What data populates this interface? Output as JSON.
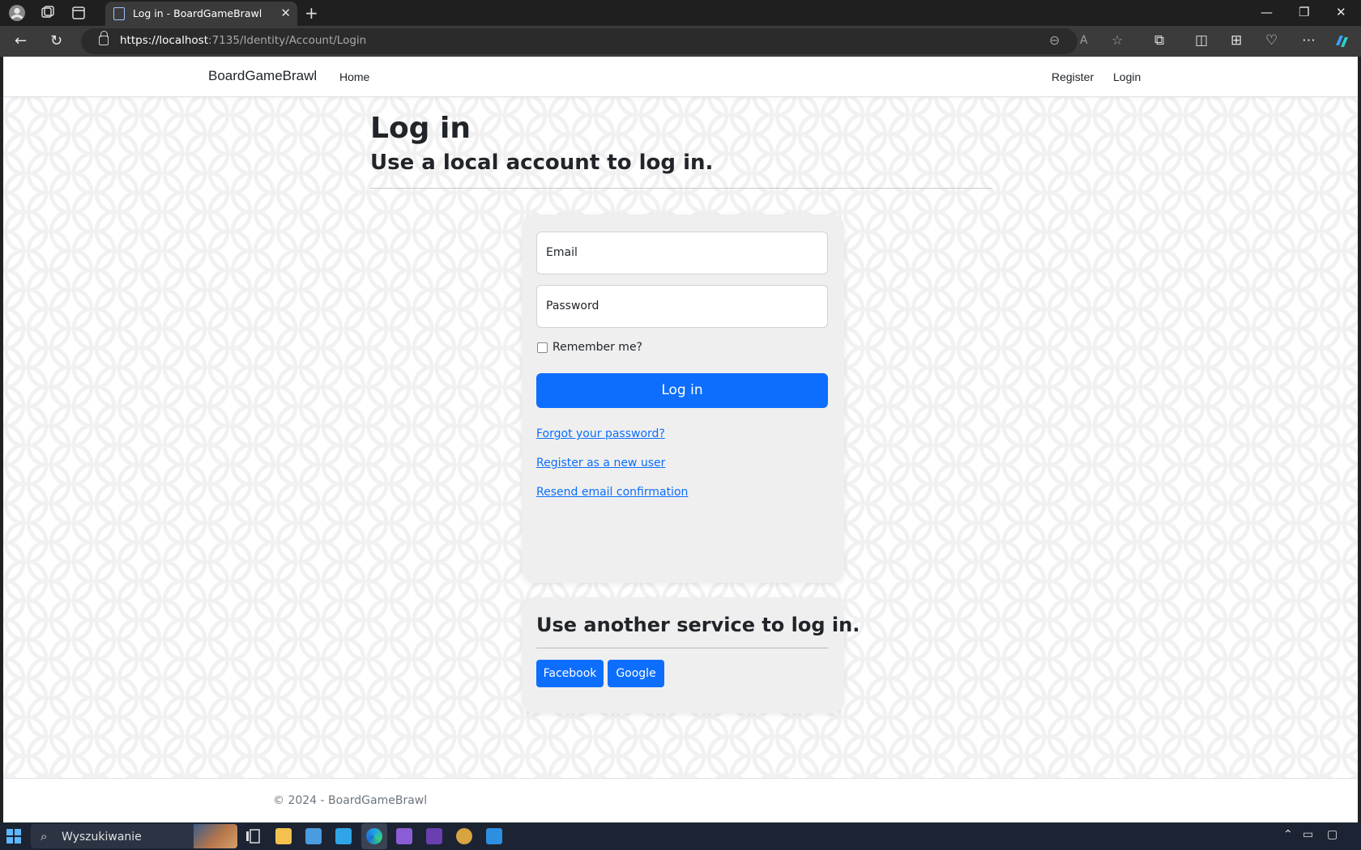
{
  "browser": {
    "tab_title": "Log in - BoardGameBrawl",
    "tab_close": "✕",
    "new_tab": "+",
    "url_host": "https://localhost",
    "url_path": ":7135/Identity/Account/Login",
    "window_controls": {
      "minimize": "—",
      "restore": "❐",
      "close": "✕"
    }
  },
  "site": {
    "brand": "BoardGameBrawl",
    "nav": {
      "home": "Home",
      "register": "Register",
      "login": "Login"
    }
  },
  "page": {
    "title": "Log in",
    "subtitle": "Use a local account to log in."
  },
  "form": {
    "email_label": "Email",
    "password_label": "Password",
    "remember_label": "Remember me?",
    "remember_checked": false,
    "submit_label": "Log in",
    "links": {
      "forgot": "Forgot your password?",
      "register": "Register as a new user",
      "resend": "Resend email confirmation"
    }
  },
  "external": {
    "title": "Use another service to log in.",
    "facebook": "Facebook",
    "google": "Google"
  },
  "footer": {
    "copyright": "© 2024 - BoardGameBrawl"
  },
  "taskbar": {
    "search_placeholder": "Wyszukiwanie"
  },
  "colors": {
    "primary": "#0d6efd",
    "card_bg": "#efefef",
    "chrome_dark": "#1f1f1f",
    "taskbar": "#1c2433"
  }
}
